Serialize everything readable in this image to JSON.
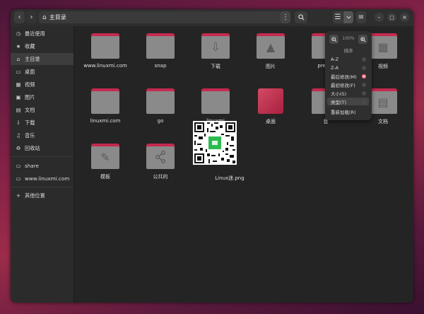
{
  "header": {
    "back_icon": "chevron-left-icon",
    "forward_icon": "chevron-right-icon",
    "path_icon": "home-icon",
    "path_label": "主目录",
    "menu_icon": "kebab-icon",
    "search_icon": "search-icon",
    "view_icon": "list-view-icon",
    "view_dropdown_icon": "chevron-down-icon",
    "main_menu_icon": "hamburger-icon",
    "minimize_icon": "minimize-icon",
    "maximize_icon": "maximize-icon",
    "close_icon": "close-icon"
  },
  "sidebar": {
    "items": [
      {
        "label": "最近使用",
        "icon": "clock-icon"
      },
      {
        "label": "收藏",
        "icon": "star-icon"
      },
      {
        "label": "主目录",
        "icon": "home-icon",
        "active": true
      },
      {
        "label": "桌面",
        "icon": "desktop-icon"
      },
      {
        "label": "视频",
        "icon": "video-icon"
      },
      {
        "label": "图片",
        "icon": "image-icon"
      },
      {
        "label": "文档",
        "icon": "document-icon"
      },
      {
        "label": "下载",
        "icon": "download-icon"
      },
      {
        "label": "音乐",
        "icon": "music-icon"
      },
      {
        "label": "回收站",
        "icon": "trash-icon"
      },
      {
        "label": "share",
        "icon": "folder-icon"
      },
      {
        "label": "www.linuxmi.com",
        "icon": "folder-icon"
      },
      {
        "label": "其他位置",
        "icon": "plus-icon"
      }
    ]
  },
  "files": [
    {
      "name": "www.linuxmi.com",
      "emblem": ""
    },
    {
      "name": "snap",
      "emblem": ""
    },
    {
      "name": "下载",
      "emblem": "download-icon"
    },
    {
      "name": "图片",
      "emblem": "image-icon"
    },
    {
      "name": "prettie",
      "emblem": ""
    },
    {
      "name": "视频",
      "emblem": "video-icon"
    },
    {
      "name": "linuxmi.com",
      "emblem": ""
    },
    {
      "name": "go",
      "emblem": ""
    },
    {
      "name": "linuxmi",
      "emblem": ""
    },
    {
      "name": "桌面",
      "emblem": "desktop-icon"
    },
    {
      "name": "音",
      "emblem": ""
    },
    {
      "name": "文档",
      "emblem": "document-icon"
    },
    {
      "name": "模板",
      "emblem": "template-icon"
    },
    {
      "name": "公共的",
      "emblem": "share-icon"
    },
    {
      "name": "Linux迷.png",
      "emblem": "qr-image"
    }
  ],
  "zoom_popover": {
    "zoom_out_icon": "zoom-out-icon",
    "zoom_value": "100%",
    "zoom_in_icon": "zoom-in-icon",
    "sort_title": "排序",
    "options": [
      {
        "label": "A-Z",
        "checked": false
      },
      {
        "label": "Z-A",
        "checked": false
      },
      {
        "label": "最后修改(M)",
        "checked": true
      },
      {
        "label": "最初修改(F)",
        "checked": false
      },
      {
        "label": "大小(S)",
        "checked": false
      },
      {
        "label": "类型(T)",
        "checked": false,
        "highlighted": true
      }
    ],
    "reload_label": "重新加载(R)"
  },
  "colors": {
    "accent": "#e8506a",
    "folder_tab": "#c4294f",
    "folder_body": "#8a8a8a"
  }
}
